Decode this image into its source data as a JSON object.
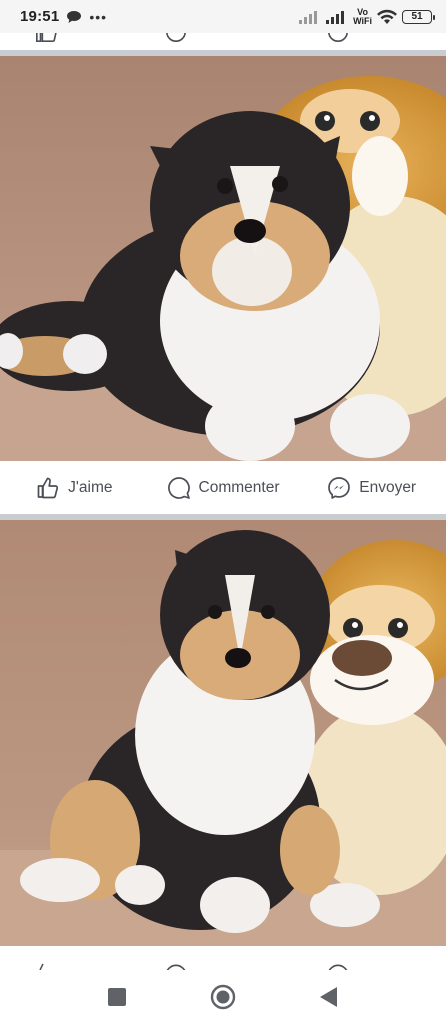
{
  "status_bar": {
    "time": "19:51",
    "network": "Vo\nWiFi",
    "battery": "51",
    "icons": [
      "chat-bubble-icon",
      "more-dots-icon",
      "signal-icon",
      "signal-icon",
      "wifi-icon",
      "battery-icon"
    ]
  },
  "posts": [
    {
      "photo_desc_icon": "puppy-with-plush-lion-photo",
      "actions": {
        "like": "J'aime",
        "comment": "Commenter",
        "send": "Envoyer"
      }
    },
    {
      "photo_desc_icon": "puppy-sitting-with-plush-lion-photo"
    }
  ],
  "nav": {
    "icons": [
      "recents-square-icon",
      "home-circle-icon",
      "back-triangle-icon"
    ]
  },
  "colors": {
    "status_bg": "#f5f5f5",
    "separator": "#c9ccd1",
    "action_text": "#4b4f56",
    "couch": "#b48f79"
  }
}
